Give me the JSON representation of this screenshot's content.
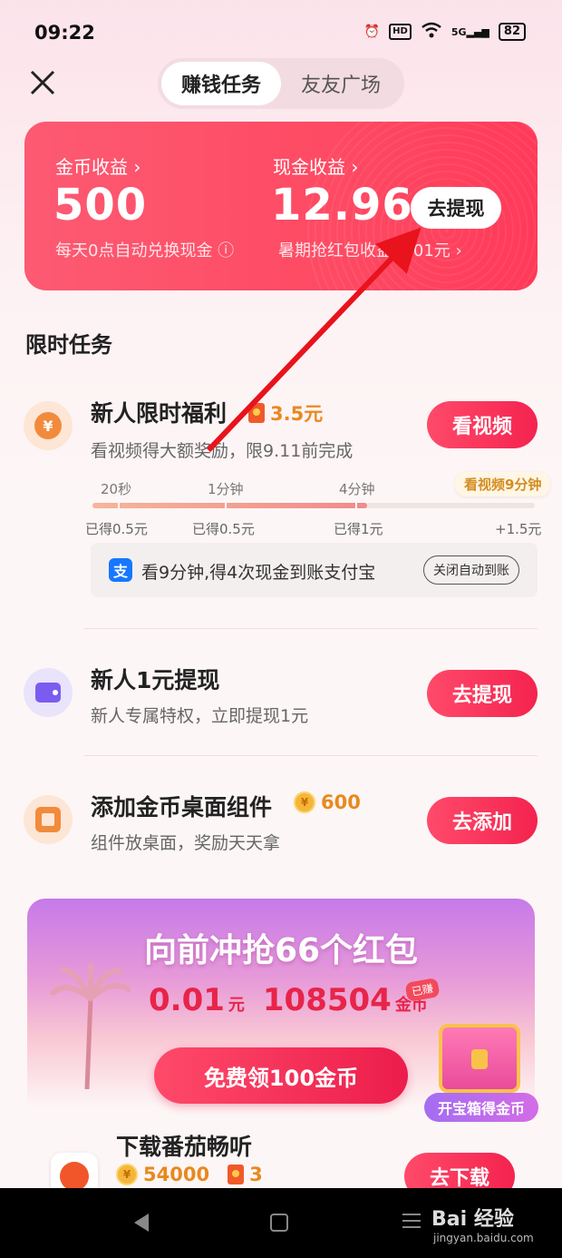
{
  "status": {
    "time": "09:22",
    "hd": "HD",
    "network": "5G",
    "battery": "82"
  },
  "tabs": [
    {
      "label": "赚钱任务"
    },
    {
      "label": "友友广场"
    }
  ],
  "earnings": {
    "coin_label": "金币收益 ›",
    "coin_value": "500",
    "coin_note": "每天0点自动兑换现金 ⓘ",
    "cash_label": "现金收益 ›",
    "cash_value": "12.96",
    "cash_note": "暑期抢红包收益 0.01元 ›",
    "withdraw_label": "去提现"
  },
  "section_title": "限时任务",
  "tasks": [
    {
      "title": "新人限时福利",
      "reward": "3.5元",
      "subtitle": "看视频得大额奖励，限9.11前完成",
      "button": "看视频",
      "milestones": [
        {
          "time": "20秒",
          "earned": "已得0.5元"
        },
        {
          "time": "1分钟",
          "earned": "已得0.5元"
        },
        {
          "time": "4分钟",
          "earned": "已得1元"
        },
        {
          "time": "看视频9分钟",
          "earned": "+1.5元"
        }
      ],
      "progress": 0.62,
      "alipay_icon": "支",
      "alipay_text": "看9分钟,得4次现金到账支付宝",
      "auto_button": "关闭自动到账"
    },
    {
      "title": "新人1元提现",
      "subtitle": "新人专属特权，立即提现1元",
      "button": "去提现"
    },
    {
      "title": "添加金币桌面组件",
      "reward": "600",
      "subtitle": "组件放桌面，奖励天天拿",
      "button": "去添加"
    }
  ],
  "banner": {
    "title": "向前冲抢66个红包",
    "amount_cash": "0.01",
    "amount_cash_unit": "元",
    "amount_coins": "108504",
    "amount_coins_unit": "金币",
    "earned_tag": "已赚",
    "free_button": "免费领100金币",
    "chest_label": "开宝箱得金币"
  },
  "app_task": {
    "title": "下载番茄畅听",
    "coins": "54000",
    "packets": "3",
    "button": "去下载"
  },
  "watermark": {
    "brand": "Bai 经验",
    "url": "jingyan.baidu.com"
  },
  "colors": {
    "accent": "#f4234f",
    "card": "#fe4a63",
    "coin": "#e8891f"
  }
}
